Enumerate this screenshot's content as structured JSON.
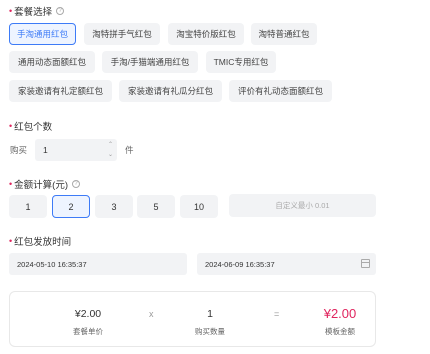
{
  "package": {
    "label": "套餐选择",
    "help_icon": "question-circle-icon",
    "options": [
      "手淘通用红包",
      "淘特拼手气红包",
      "淘宝特价版红包",
      "淘特普通红包",
      "通用动态面额红包",
      "手淘/手猫端通用红包",
      "TMIC专用红包",
      "家装邀请有礼定额红包",
      "家装邀请有礼瓜分红包",
      "评价有礼动态面额红包"
    ],
    "selected": "手淘通用红包"
  },
  "quantity": {
    "label": "红包个数",
    "prefix": "购买",
    "value": "1",
    "unit": "件"
  },
  "amount": {
    "label": "金额计算(元)",
    "help_icon": "question-circle-icon",
    "options": [
      "1",
      "2",
      "3",
      "5",
      "10"
    ],
    "selected": "2",
    "custom_placeholder": "自定义最小 0.01"
  },
  "time": {
    "label": "红包发放时间",
    "start": "2024-05-10 16:35:37",
    "end": "2024-06-09 16:35:37",
    "calendar_icon": "calendar-icon"
  },
  "summary": {
    "unit_price": "¥2.00",
    "unit_price_label": "套餐单价",
    "times": "x",
    "count": "1",
    "count_label": "购买数量",
    "equals": "=",
    "total": "¥2.00",
    "total_label": "模板金额"
  },
  "colors": {
    "accent": "#3d7bf7",
    "required": "#e0245e",
    "total": "#e0245e"
  }
}
